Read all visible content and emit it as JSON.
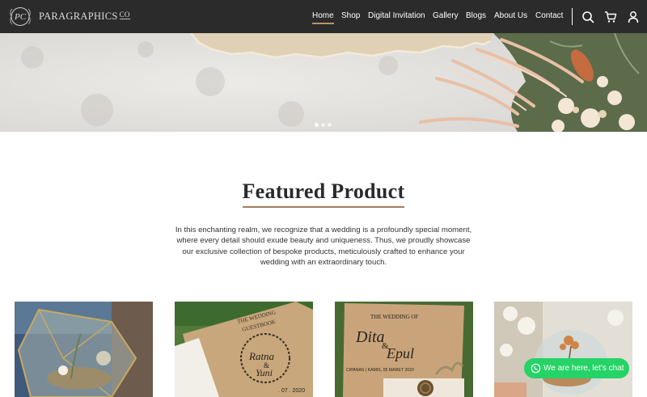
{
  "brand": {
    "name": "PARAGRAPHICS",
    "suffix": "CO",
    "logo_icon": "monogram-logo-icon"
  },
  "nav": {
    "items": [
      {
        "label": "Home",
        "active": true
      },
      {
        "label": "Shop",
        "active": false
      },
      {
        "label": "Digital Invitation",
        "active": false
      },
      {
        "label": "Gallery",
        "active": false
      },
      {
        "label": "Blogs",
        "active": false
      },
      {
        "label": "About Us",
        "active": false
      },
      {
        "label": "Contact",
        "active": false
      }
    ],
    "icons": [
      "search-icon",
      "cart-icon",
      "user-icon"
    ]
  },
  "hero": {
    "slides": 3,
    "active_slide": 1
  },
  "featured": {
    "title": "Featured Product",
    "description": "In this enchanting realm, we recognize that a wedding is a profoundly special moment, where every detail should exude beauty and uniqueness. Thus, we proudly showcase our exclusive collection of bespoke products, meticulously crafted to enhance your wedding with an extraordinary touch."
  },
  "products": [
    {
      "name": "glass-terrarium-box"
    },
    {
      "name": "wedding-guestbook",
      "texts": {
        "top": "THE WEDDING",
        "top2": "GUESTBOOK",
        "names": "Ratna",
        "amp": "&",
        "names2": "Yuni",
        "date": ". 07 . 2020"
      }
    },
    {
      "name": "wedding-invitation",
      "texts": {
        "top": "THE WEDDING OF",
        "names": "Dita",
        "amp": "&",
        "names2": "Epul",
        "date": "CIPANAS | KAMIS, 05 MARET 2020"
      }
    },
    {
      "name": "flower-terrarium"
    }
  ],
  "chat": {
    "label": "We are here, let's chat",
    "icon": "whatsapp-icon"
  },
  "colors": {
    "nav_bg": "#2b2b2b",
    "accent": "#b99366",
    "chat_green": "#25d366",
    "title_rule": "#a07d59"
  }
}
